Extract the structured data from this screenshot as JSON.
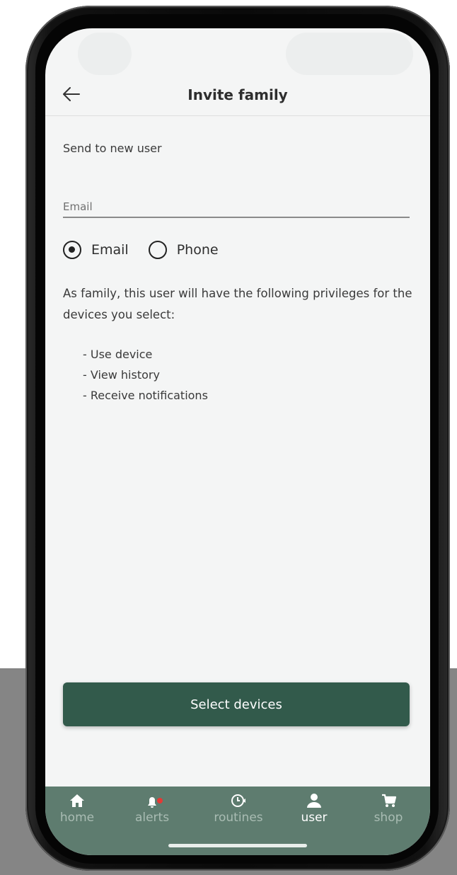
{
  "header": {
    "title": "Invite family"
  },
  "form": {
    "section_label": "Send to new user",
    "email_placeholder": "Email",
    "email_value": "",
    "contact_method": {
      "options": [
        "Email",
        "Phone"
      ],
      "selected": "Email"
    },
    "privileges_text": "As family, this user will have the following privileges for the devices you select:",
    "privileges": [
      "- Use device",
      "- View history",
      "- Receive notifications"
    ]
  },
  "actions": {
    "select_devices_label": "Select devices"
  },
  "tabbar": {
    "items": [
      {
        "label": "home",
        "icon": "home-icon",
        "active": false
      },
      {
        "label": "alerts",
        "icon": "bell-icon",
        "active": false
      },
      {
        "label": "routines",
        "icon": "clock-icon",
        "active": false
      },
      {
        "label": "user",
        "icon": "user-icon",
        "active": true
      },
      {
        "label": "shop",
        "icon": "cart-icon",
        "active": false
      }
    ]
  },
  "colors": {
    "primary": "#325a4b",
    "tabbar": "#5e7c6f",
    "alert_dot": "#e53935",
    "background": "#f4f5f5"
  }
}
